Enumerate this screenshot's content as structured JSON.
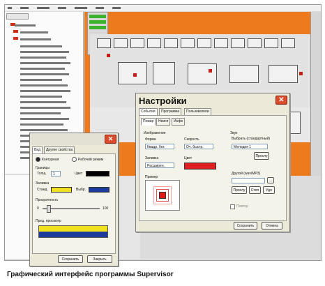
{
  "caption": "Графический интерфейс программы Supervisor",
  "settings_dialog": {
    "title": "Настройки",
    "tabs": [
      "События",
      "Программа",
      "Пользователи"
    ],
    "subtabs": [
      "Пожар",
      "Неисп",
      "Инфо"
    ],
    "image_group": "Изображение",
    "form_label": "Форма",
    "form_value": "Квадр. без",
    "speed_label": "Скорость",
    "speed_value": "Оч. быстр.",
    "fill_label": "Заливка",
    "fill_value": "Расширен.",
    "color_label": "Цвет",
    "color_value": "#e02020",
    "preview_label": "Пример",
    "sound_group": "Звук",
    "sound_select_label": "Выбрать (стандартный)",
    "sound_select_value": "Мелодия 1",
    "sound_listen": "Прослу",
    "sound_other_label": "Другой (wav/MP3)",
    "sound_buttons": [
      "Прослу",
      "Стоп",
      "Удл"
    ],
    "sound_path_button": "...",
    "repeat_label": "Повтор",
    "save": "Сохранить",
    "cancel": "Отмена"
  },
  "props_dialog": {
    "tabs": [
      "Вид",
      "Другие свойства"
    ],
    "radio_contour": "Контурная",
    "radio_work": "Рабочий режим",
    "border_label": "Границы",
    "thickness_label": "Толщ.",
    "thickness_value": "1",
    "border_color_label": "Цвет",
    "border_color": "#000000",
    "fill_group": "Заливка",
    "fill_std_label": "Станд.",
    "fill_std_color": "#f0e020",
    "fill_sel_label": "Выбр.",
    "fill_sel_color": "#1c3c9c",
    "transparency_label": "Прозрачность",
    "transparency_min": "0",
    "transparency_max": "100",
    "transparency_value": 0.1,
    "preview_label": "Пред. просмотр",
    "save": "Сохранить",
    "close": "Закрыть"
  },
  "colors": {
    "map_bg": "#ee7a1e",
    "close_btn": "#d94b2a"
  }
}
